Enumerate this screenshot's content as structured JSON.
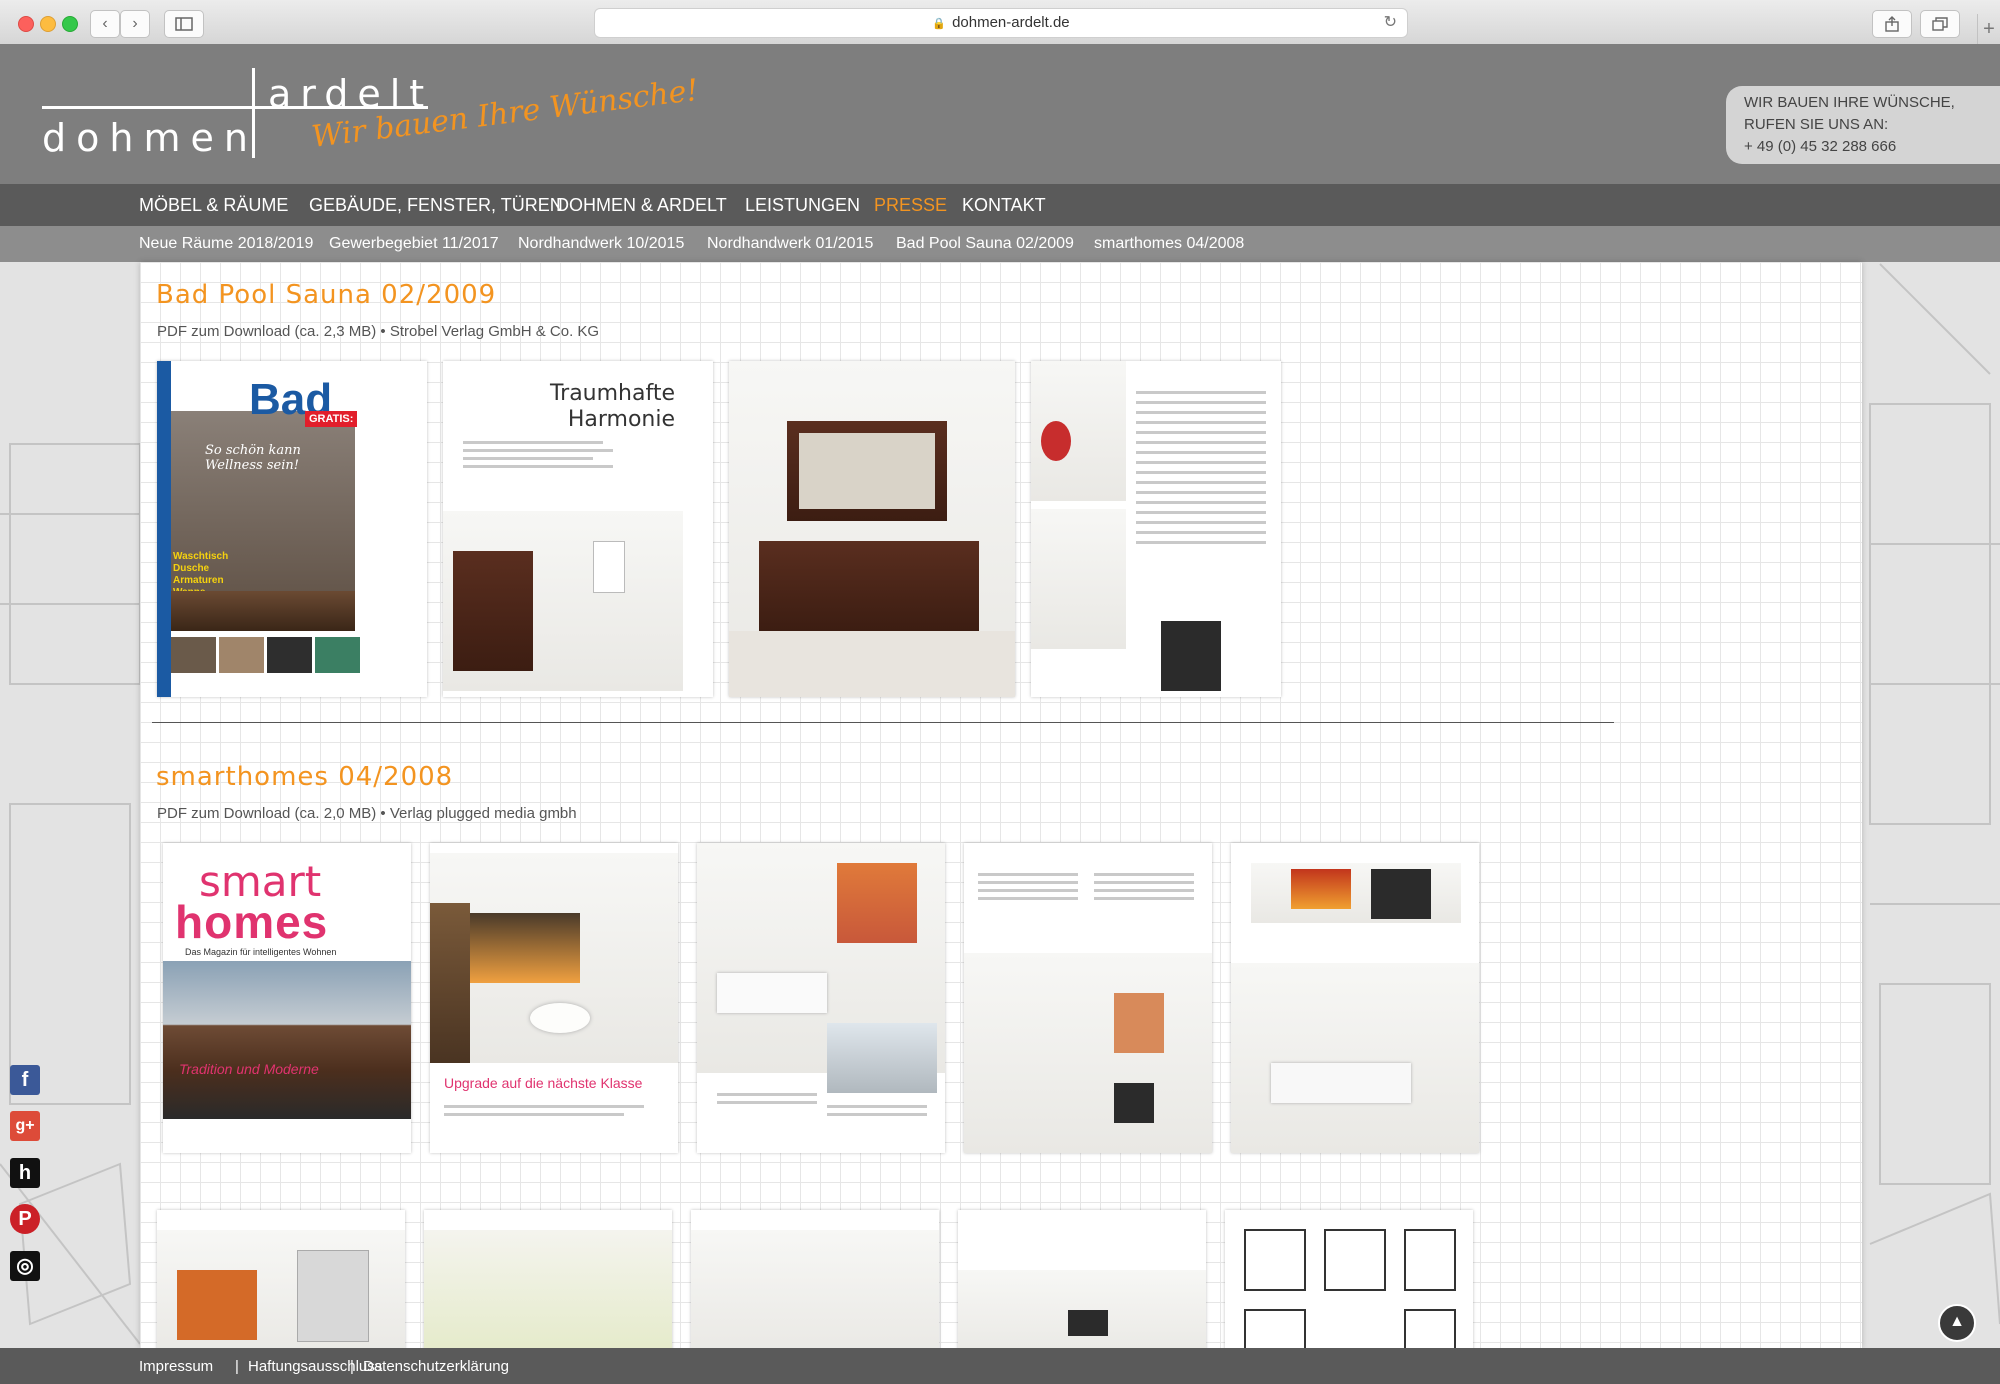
{
  "browser": {
    "url": "dohmen-ardelt.de",
    "back_glyph": "‹",
    "forward_glyph": "›",
    "plus_glyph": "+"
  },
  "logo": {
    "top_text": "ardelt",
    "bottom_text": "dohmen",
    "slogan": "Wir bauen Ihre Wünsche!"
  },
  "contact_box": {
    "line1": "WIR BAUEN IHRE WÜNSCHE,",
    "line2": "RUFEN SIE UNS AN:",
    "phone": "+ 49 (0) 45 32 288 666"
  },
  "main_nav": [
    {
      "label": "MÖBEL & RÄUME",
      "active": false
    },
    {
      "label": "GEBÄUDE, FENSTER, TÜREN",
      "active": false
    },
    {
      "label": "DOHMEN & ARDELT",
      "active": false
    },
    {
      "label": "LEISTUNGEN",
      "active": false
    },
    {
      "label": "PRESSE",
      "active": true
    },
    {
      "label": "KONTAKT",
      "active": false
    }
  ],
  "sub_nav": [
    "Neue Räume 2018/2019",
    "Gewerbegebiet 11/2017",
    "Nordhandwerk 10/2015",
    "Nordhandwerk 01/2015",
    "Bad Pool Sauna 02/2009",
    "smarthomes 04/2008"
  ],
  "sections": [
    {
      "title": "Bad Pool Sauna 02/2009",
      "subtitle": "PDF zum Download (ca. 2,3 MB) • Strobel Verlag GmbH & Co. KG",
      "cover": {
        "title": "Bad",
        "badge": "GRATIS:",
        "tagline": "So schön kann Wellness sein!",
        "items": "Waschtisch\nDusche\nArmaturen\nWanne\nHeizkörper"
      },
      "article_title": "Traumhafte Harmonie"
    },
    {
      "title": "smarthomes 04/2008",
      "subtitle": "PDF zum Download (ca. 2,0 MB) • Verlag plugged media gmbh",
      "cover": {
        "title_top": "smart",
        "title_bottom": "homes",
        "tagline": "Das Magazin für intelligentes Wohnen",
        "banner": "Tradition und Moderne"
      },
      "article_title": "Upgrade auf die nächste Klasse"
    }
  ],
  "footer": [
    "Impressum",
    "Haftungsausschluss",
    "Datenschutzerklärung"
  ],
  "footer_separator": "|",
  "social": [
    {
      "name": "facebook",
      "glyph": "f",
      "color": "#3b5998"
    },
    {
      "name": "google-plus",
      "glyph": "g+",
      "color": "#dd4b39"
    },
    {
      "name": "houzz",
      "glyph": "h",
      "color": "#111111"
    },
    {
      "name": "pinterest",
      "glyph": "P",
      "color": "#cb2027"
    },
    {
      "name": "instagram",
      "glyph": "◎",
      "color": "#111111"
    }
  ],
  "colors": {
    "accent": "#f39420",
    "header_bg": "#7e7e7e",
    "nav_bg": "#5a5a5a",
    "subnav_bg": "#8d8d8d"
  }
}
